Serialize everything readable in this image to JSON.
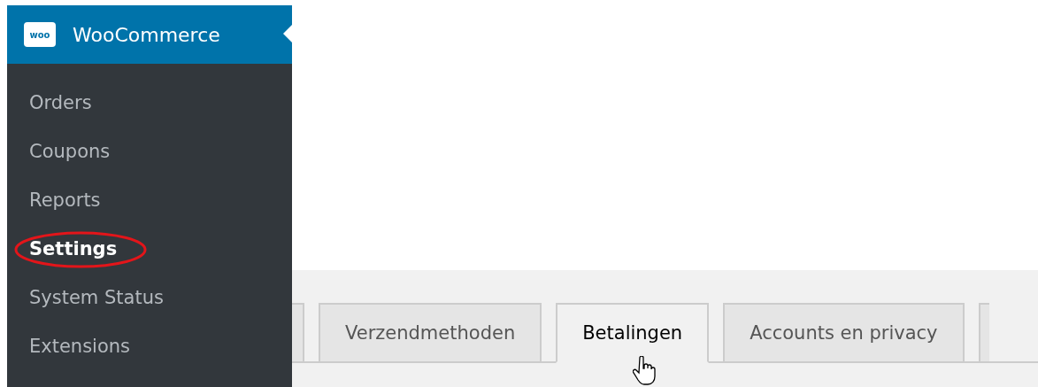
{
  "sidebar": {
    "header": {
      "logo": "woo",
      "title": "WooCommerce"
    },
    "items": [
      {
        "label": "Orders",
        "selected": false,
        "circled": false
      },
      {
        "label": "Coupons",
        "selected": false,
        "circled": false
      },
      {
        "label": "Reports",
        "selected": false,
        "circled": false
      },
      {
        "label": "Settings",
        "selected": true,
        "circled": true
      },
      {
        "label": "System Status",
        "selected": false,
        "circled": false
      },
      {
        "label": "Extensions",
        "selected": false,
        "circled": false
      }
    ]
  },
  "tabs": [
    {
      "label": "Verzendmethoden",
      "selected": false,
      "pointer": false
    },
    {
      "label": "Betalingen",
      "selected": true,
      "pointer": true
    },
    {
      "label": "Accounts en privacy",
      "selected": false,
      "pointer": false
    }
  ]
}
